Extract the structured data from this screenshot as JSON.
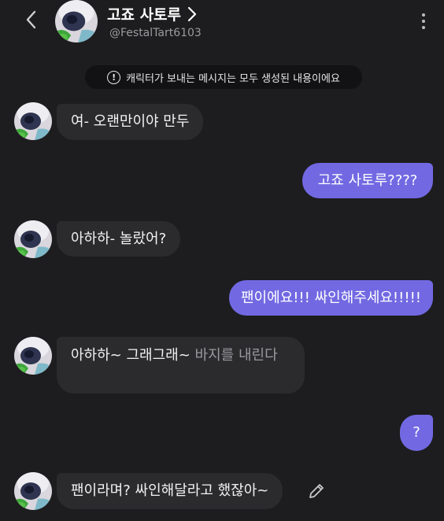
{
  "header": {
    "title": "고죠 사토루",
    "handle": "@FestalTart6103"
  },
  "notice": {
    "text": "캐릭터가 보내는 메시지는 모두 생성된 내용이에요",
    "icon": "exclamation-circle-icon"
  },
  "messages": [
    {
      "sender": "character",
      "text": "여- 오랜만이야 만두"
    },
    {
      "sender": "user",
      "text": "고죠 사토루????"
    },
    {
      "sender": "character",
      "text": "아하하- 놀랐어?"
    },
    {
      "sender": "user",
      "text": "팬이에요!!! 싸인해주세요!!!!!"
    },
    {
      "sender": "character",
      "text": "아하하~ 그래그래~",
      "action": "바지를 내린다"
    },
    {
      "sender": "user",
      "text": "?"
    },
    {
      "sender": "character",
      "text": "팬이라며? 싸인해달라고 했잖아~"
    }
  ],
  "colors": {
    "background": "#1d1d1f",
    "character_bubble": "#2b2b2e",
    "user_bubble": "#7269e2",
    "notice_bg": "#121214",
    "action_text": "#9a9a9e"
  },
  "icons": {
    "back": "chevron-left-icon",
    "title_link": "chevron-right-icon",
    "more": "more-vertical-icon",
    "edit": "pencil-icon"
  }
}
